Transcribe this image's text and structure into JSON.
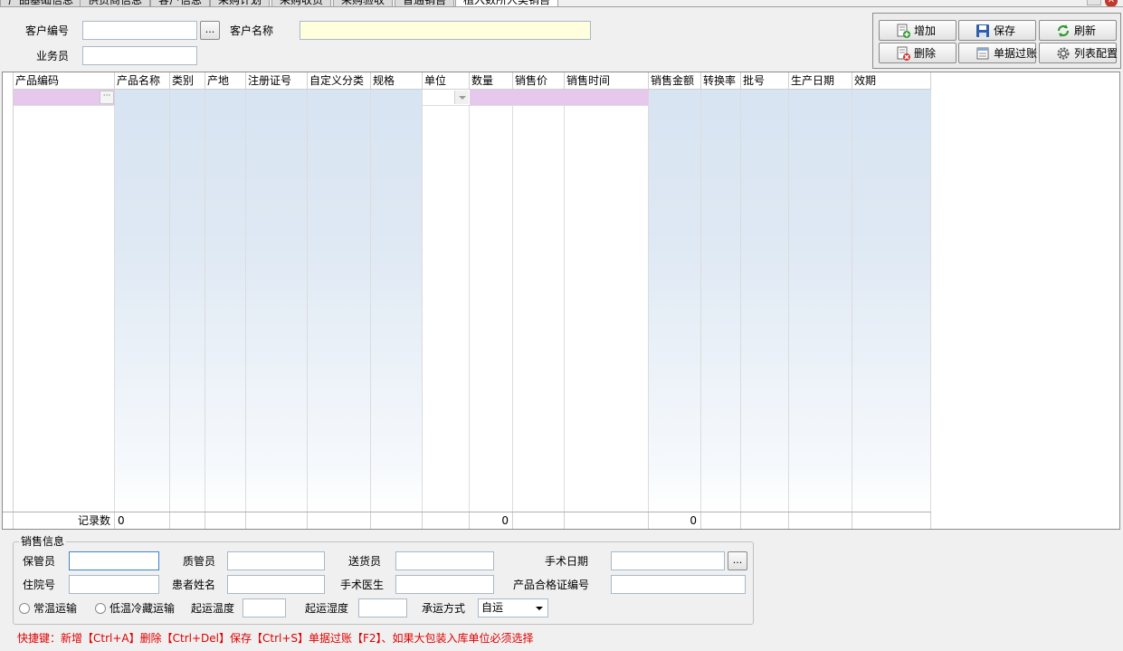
{
  "tabs": [
    "产品基础信息",
    "供货商信息",
    "客户信息",
    "采购计划",
    "采购收货",
    "采购验收",
    "普通销售",
    "植入数所人类销售"
  ],
  "header": {
    "customer_code_label": "客户编号",
    "customer_code_value": "",
    "customer_name_label": "客户名称",
    "customer_name_value": "",
    "salesman_label": "业务员",
    "salesman_value": "",
    "ellipsis": "..."
  },
  "toolbar": {
    "add": "增加",
    "save": "保存",
    "refresh": "刷新",
    "delete": "删除",
    "post": "单据过账",
    "column_config": "列表配置"
  },
  "grid": {
    "columns": [
      "产品编码",
      "产品名称",
      "类别",
      "产地",
      "注册证号",
      "自定义分类",
      "规格",
      "单位",
      "数量",
      "销售价",
      "销售时间",
      "销售金额",
      "转换率",
      "批号",
      "生产日期",
      "效期"
    ],
    "footer": {
      "record_label": "记录数",
      "record_count": "0",
      "qty_total": "0",
      "amount_total": "0"
    },
    "cell_ellipsis": "···"
  },
  "sales": {
    "legend": "销售信息",
    "custodian_label": "保管员",
    "quality_label": "质管员",
    "delivery_label": "送货员",
    "surgery_date_label": "手术日期",
    "hospital_no_label": "住院号",
    "patient_label": "患者姓名",
    "surgeon_label": "手术医生",
    "cert_label": "产品合格证编号",
    "normal_transport": "常温运输",
    "cold_transport": "低温冷藏运输",
    "start_temp_label": "起运温度",
    "start_humidity_label": "起运湿度",
    "carrier_label": "承运方式",
    "carrier_value": "自运",
    "ellipsis": "..."
  },
  "hint": "快捷键：新增【Ctrl+A】删除【Ctrl+Del】保存【Ctrl+S】单据过账【F2】、如果大包装入库单位必须选择",
  "colors": {
    "grid_shade": "#d6e3f1",
    "edit_cell_pink": "#e6c8ec",
    "hint_red": "#e00000",
    "yellow_input": "#ffffdd"
  }
}
